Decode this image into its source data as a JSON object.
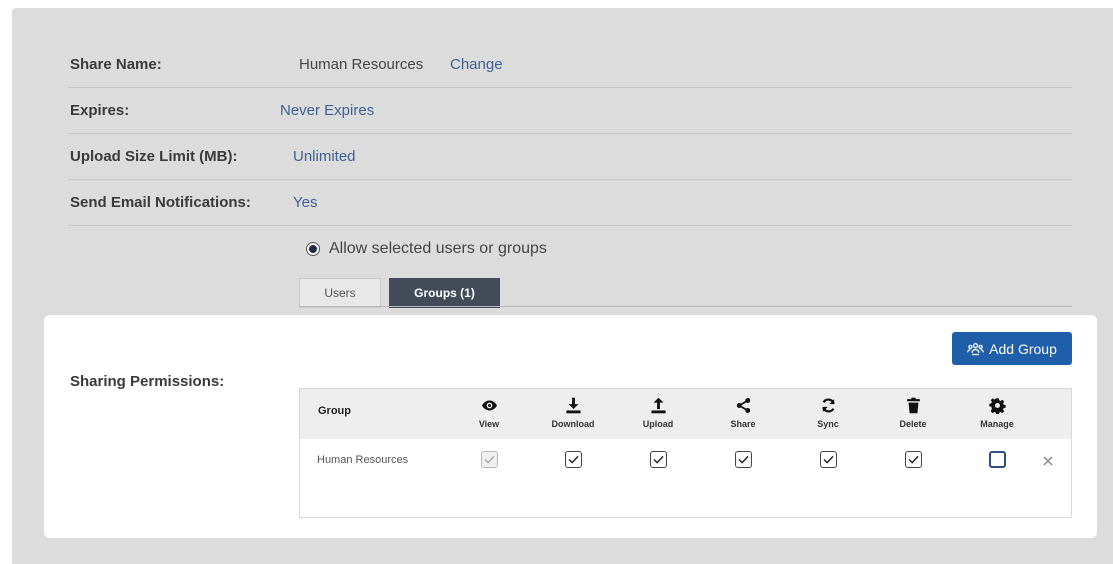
{
  "share_name": {
    "label": "Share Name:",
    "value": "Human Resources",
    "change_link": "Change"
  },
  "expires": {
    "label": "Expires:",
    "value": "Never Expires"
  },
  "upload_limit": {
    "label": "Upload Size Limit (MB):",
    "value": "Unlimited"
  },
  "email_notifications": {
    "label": "Send Email Notifications:",
    "value": "Yes"
  },
  "access_option": {
    "label": "Allow selected users or groups",
    "selected": true
  },
  "tabs": [
    {
      "label": "Users",
      "active": false
    },
    {
      "label": "Groups (1)",
      "active": true
    }
  ],
  "sharing_permissions": {
    "label": "Sharing Permissions:"
  },
  "add_group_button": {
    "label": "Add Group",
    "icon": "users-icon"
  },
  "table": {
    "group_header": "Group",
    "columns": [
      {
        "label": "View",
        "icon": "eye-icon"
      },
      {
        "label": "Download",
        "icon": "download-icon"
      },
      {
        "label": "Upload",
        "icon": "upload-icon"
      },
      {
        "label": "Share",
        "icon": "share-icon"
      },
      {
        "label": "Sync",
        "icon": "sync-icon"
      },
      {
        "label": "Delete",
        "icon": "trash-icon"
      },
      {
        "label": "Manage",
        "icon": "gear-icon"
      }
    ],
    "rows": [
      {
        "name": "Human Resources",
        "view": true,
        "view_disabled": true,
        "download": true,
        "upload": true,
        "share": true,
        "sync": true,
        "delete": true,
        "manage": false
      }
    ]
  },
  "colors": {
    "link": "#3d5f95",
    "accent_button": "#1f5fa9",
    "active_tab": "#434b59"
  }
}
